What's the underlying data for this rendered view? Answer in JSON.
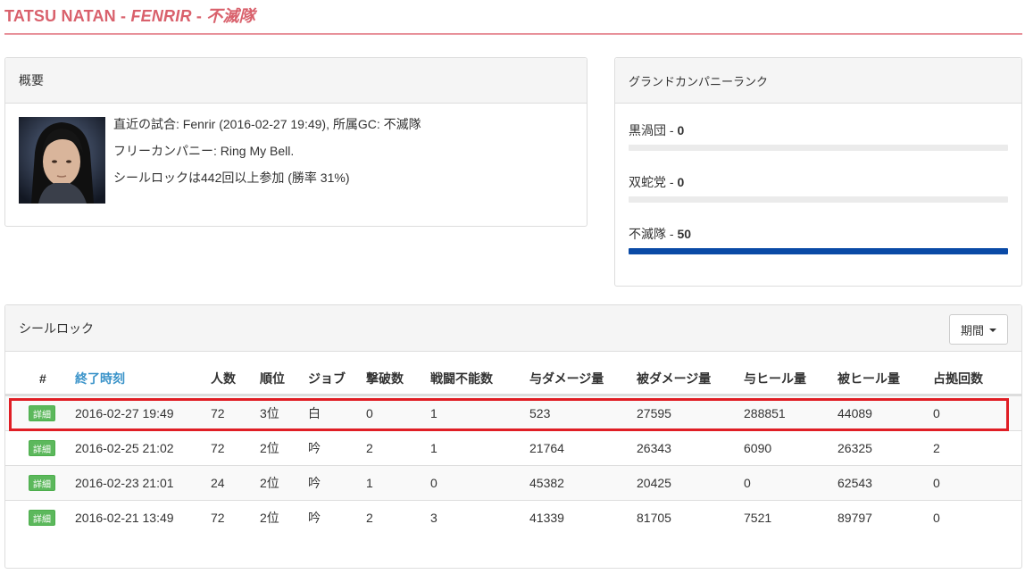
{
  "header": {
    "name": "TATSU NATAN",
    "sep1": " - ",
    "world": "FENRIR",
    "sep2": " - ",
    "gc": "不滅隊"
  },
  "overview": {
    "title": "概要",
    "avatar_icon": "character-portrait",
    "line1": "直近の試合: Fenrir (2016-02-27 19:49), 所属GC: 不滅隊",
    "line2": "フリーカンパニー: Ring My Bell.",
    "line3": "シールロックは442回以上参加 (勝率 31%)"
  },
  "gc_rank": {
    "title": "グランドカンパニーランク",
    "items": [
      {
        "label": "黒渦団 - ",
        "value": "0",
        "fill": 0
      },
      {
        "label": "双蛇党 - ",
        "value": "0",
        "fill": 0
      },
      {
        "label": "不滅隊 - ",
        "value": "50",
        "fill": 1.0
      }
    ],
    "bar_color": "#0a4aa6"
  },
  "seal_rock": {
    "title": "シールロック",
    "period_label": "期間",
    "columns": [
      "#",
      "終了時刻",
      "人数",
      "順位",
      "ジョブ",
      "撃破数",
      "戦闘不能数",
      "与ダメージ量",
      "被ダメージ量",
      "与ヒール量",
      "被ヒール量",
      "占拠回数"
    ],
    "rows": [
      {
        "btn": "詳細",
        "time": "2016-02-27 19:49",
        "players": "72",
        "rank": "3位",
        "job": "白",
        "kills": "0",
        "deaths": "1",
        "dmg_dealt": "523",
        "dmg_taken": "27595",
        "heal_dealt": "288851",
        "heal_taken": "44089",
        "captures": "0"
      },
      {
        "btn": "詳細",
        "time": "2016-02-25 21:02",
        "players": "72",
        "rank": "2位",
        "job": "吟",
        "kills": "2",
        "deaths": "1",
        "dmg_dealt": "21764",
        "dmg_taken": "26343",
        "heal_dealt": "6090",
        "heal_taken": "26325",
        "captures": "2"
      },
      {
        "btn": "詳細",
        "time": "2016-02-23 21:01",
        "players": "24",
        "rank": "2位",
        "job": "吟",
        "kills": "1",
        "deaths": "0",
        "dmg_dealt": "45382",
        "dmg_taken": "20425",
        "heal_dealt": "0",
        "heal_taken": "62543",
        "captures": "0"
      },
      {
        "btn": "詳細",
        "time": "2016-02-21 13:49",
        "players": "72",
        "rank": "2位",
        "job": "吟",
        "kills": "2",
        "deaths": "3",
        "dmg_dealt": "41339",
        "dmg_taken": "81705",
        "heal_dealt": "7521",
        "heal_taken": "89797",
        "captures": "0"
      }
    ],
    "highlight_color": "#e01e25"
  },
  "colors": {
    "title": "#d9616c",
    "link": "#3a93c9",
    "button": "#5cb85c"
  }
}
